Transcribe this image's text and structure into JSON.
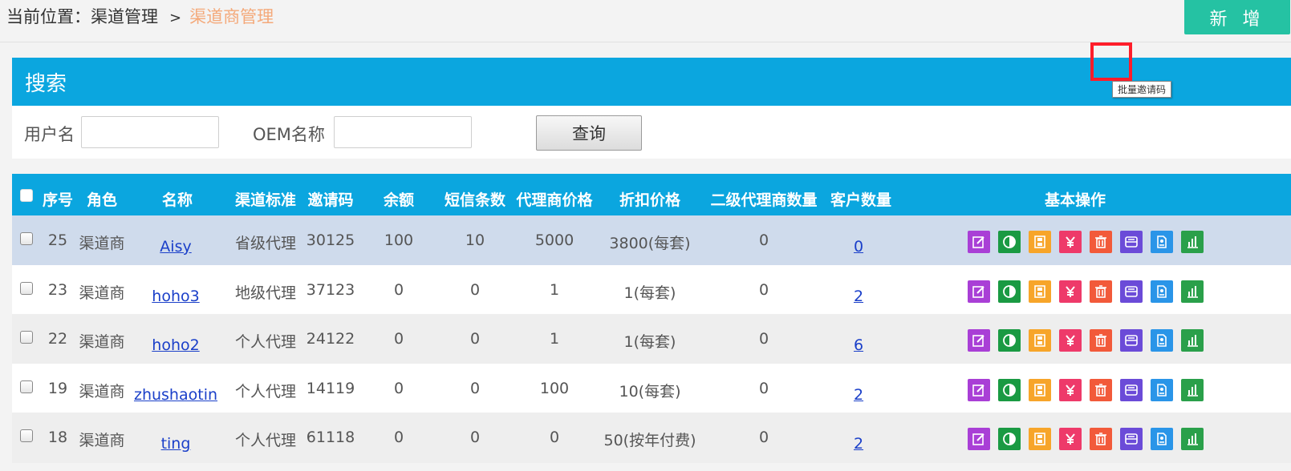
{
  "breadcrumb": {
    "prefix": "当前位置：渠道管理",
    "separator": ">",
    "current": "渠道商管理"
  },
  "add_button": "新 增",
  "search": {
    "title": "搜索",
    "username_label": "用户名",
    "oem_label": "OEM名称",
    "username_value": "",
    "oem_value": "",
    "query_button": "查询"
  },
  "table": {
    "headers": {
      "seq": "序号",
      "role": "角色",
      "name": "名称",
      "standard": "渠道标准",
      "invite": "邀请码",
      "balance": "余额",
      "sms": "短信条数",
      "agent_price": "代理商价格",
      "discount": "折扣价格",
      "sub_agents": "二级代理商数量",
      "customers": "客户数量",
      "ops": "基本操作"
    },
    "rows": [
      {
        "seq": "25",
        "role": "渠道商",
        "name": "Aisy",
        "standard": "省级代理",
        "invite": "30125",
        "balance": "100",
        "sms": "10",
        "agent_price": "5000",
        "discount": "3800(每套)",
        "sub_agents": "0",
        "customers": "0"
      },
      {
        "seq": "23",
        "role": "渠道商",
        "name": "hoho3",
        "standard": "地级代理",
        "invite": "37123",
        "balance": "0",
        "sms": "0",
        "agent_price": "1",
        "discount": "1(每套)",
        "sub_agents": "0",
        "customers": "2"
      },
      {
        "seq": "22",
        "role": "渠道商",
        "name": "hoho2",
        "standard": "个人代理",
        "invite": "24122",
        "balance": "0",
        "sms": "0",
        "agent_price": "1",
        "discount": "1(每套)",
        "sub_agents": "0",
        "customers": "6"
      },
      {
        "seq": "19",
        "role": "渠道商",
        "name": "zhushaotin",
        "standard": "个人代理",
        "invite": "14119",
        "balance": "0",
        "sms": "0",
        "agent_price": "100",
        "discount": "10(每套)",
        "sub_agents": "0",
        "customers": "2"
      },
      {
        "seq": "18",
        "role": "渠道商",
        "name": "ting",
        "standard": "个人代理",
        "invite": "61118",
        "balance": "0",
        "sms": "0",
        "agent_price": "0",
        "discount": "50(按年付费)",
        "sub_agents": "0",
        "customers": "2"
      }
    ]
  },
  "actions": [
    {
      "icon": "edit-icon",
      "color": "#a93fd6"
    },
    {
      "icon": "contrast-icon",
      "color": "#1a9a43"
    },
    {
      "icon": "film-icon",
      "color": "#f7a52a"
    },
    {
      "icon": "yen-icon",
      "color": "#ee3a6a"
    },
    {
      "icon": "trash-icon",
      "color": "#f25a3a"
    },
    {
      "icon": "invite-code-icon",
      "color": "#6b4bd8"
    },
    {
      "icon": "document-icon",
      "color": "#2a95e8"
    },
    {
      "icon": "bar-chart-icon",
      "color": "#2aa04a"
    }
  ],
  "tooltip": "批量邀请码",
  "row_backgrounds": [
    "#cfdbec",
    "#ffffff",
    "#eeeeee",
    "#ffffff",
    "#eeeeee"
  ]
}
